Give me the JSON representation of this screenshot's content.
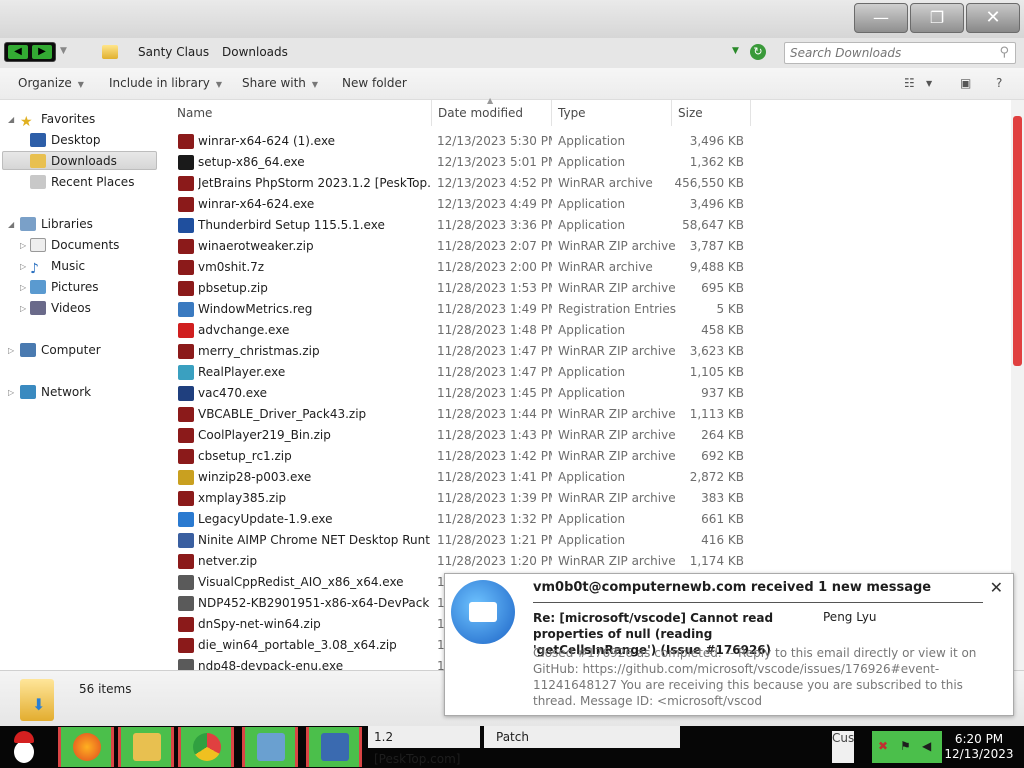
{
  "window": {
    "min_glyph": "—",
    "max_glyph": "❐",
    "close_glyph": "✕"
  },
  "address": {
    "crumbs": [
      "Santy Claus",
      "Downloads"
    ],
    "search_placeholder": "Search Downloads"
  },
  "toolbar": {
    "organize": "Organize",
    "include": "Include in library",
    "share": "Share with",
    "new_folder": "New folder",
    "help": "?"
  },
  "sidebar": {
    "favorites": "Favorites",
    "desktop": "Desktop",
    "downloads": "Downloads",
    "recent": "Recent Places",
    "libraries": "Libraries",
    "documents": "Documents",
    "music": "Music",
    "pictures": "Pictures",
    "videos": "Videos",
    "computer": "Computer",
    "network": "Network"
  },
  "columns": {
    "name": "Name",
    "date": "Date modified",
    "type": "Type",
    "size": "Size"
  },
  "files": [
    {
      "name": "winrar-x64-624 (1).exe",
      "date": "12/13/2023 5:30 PM",
      "type": "Application",
      "size": "3,496 KB",
      "color": "#8b1a1a"
    },
    {
      "name": "setup-x86_64.exe",
      "date": "12/13/2023 5:01 PM",
      "type": "Application",
      "size": "1,362 KB",
      "color": "#1a1a1a"
    },
    {
      "name": "JetBrains PhpStorm 2023.1.2 [PeskTop.co...",
      "date": "12/13/2023 4:52 PM",
      "type": "WinRAR archive",
      "size": "456,550 KB",
      "color": "#8b1a1a"
    },
    {
      "name": "winrar-x64-624.exe",
      "date": "12/13/2023 4:49 PM",
      "type": "Application",
      "size": "3,496 KB",
      "color": "#8b1a1a"
    },
    {
      "name": "Thunderbird Setup 115.5.1.exe",
      "date": "11/28/2023 3:36 PM",
      "type": "Application",
      "size": "58,647 KB",
      "color": "#1f4f9e"
    },
    {
      "name": "winaerotweaker.zip",
      "date": "11/28/2023 2:07 PM",
      "type": "WinRAR ZIP archive",
      "size": "3,787 KB",
      "color": "#8b1a1a"
    },
    {
      "name": "vm0shit.7z",
      "date": "11/28/2023 2:00 PM",
      "type": "WinRAR archive",
      "size": "9,488 KB",
      "color": "#8b1a1a"
    },
    {
      "name": "pbsetup.zip",
      "date": "11/28/2023 1:53 PM",
      "type": "WinRAR ZIP archive",
      "size": "695 KB",
      "color": "#8b1a1a"
    },
    {
      "name": "WindowMetrics.reg",
      "date": "11/28/2023 1:49 PM",
      "type": "Registration Entries",
      "size": "5 KB",
      "color": "#3a7ac0"
    },
    {
      "name": "advchange.exe",
      "date": "11/28/2023 1:48 PM",
      "type": "Application",
      "size": "458 KB",
      "color": "#d01f1f"
    },
    {
      "name": "merry_christmas.zip",
      "date": "11/28/2023 1:47 PM",
      "type": "WinRAR ZIP archive",
      "size": "3,623 KB",
      "color": "#8b1a1a"
    },
    {
      "name": "RealPlayer.exe",
      "date": "11/28/2023 1:47 PM",
      "type": "Application",
      "size": "1,105 KB",
      "color": "#3aa0c0"
    },
    {
      "name": "vac470.exe",
      "date": "11/28/2023 1:45 PM",
      "type": "Application",
      "size": "937 KB",
      "color": "#1f3f7e"
    },
    {
      "name": "VBCABLE_Driver_Pack43.zip",
      "date": "11/28/2023 1:44 PM",
      "type": "WinRAR ZIP archive",
      "size": "1,113 KB",
      "color": "#8b1a1a"
    },
    {
      "name": "CoolPlayer219_Bin.zip",
      "date": "11/28/2023 1:43 PM",
      "type": "WinRAR ZIP archive",
      "size": "264 KB",
      "color": "#8b1a1a"
    },
    {
      "name": "cbsetup_rc1.zip",
      "date": "11/28/2023 1:42 PM",
      "type": "WinRAR ZIP archive",
      "size": "692 KB",
      "color": "#8b1a1a"
    },
    {
      "name": "winzip28-p003.exe",
      "date": "11/28/2023 1:41 PM",
      "type": "Application",
      "size": "2,872 KB",
      "color": "#c9a020"
    },
    {
      "name": "xmplay385.zip",
      "date": "11/28/2023 1:39 PM",
      "type": "WinRAR ZIP archive",
      "size": "383 KB",
      "color": "#8b1a1a"
    },
    {
      "name": "LegacyUpdate-1.9.exe",
      "date": "11/28/2023 1:32 PM",
      "type": "Application",
      "size": "661 KB",
      "color": "#2a7ad0"
    },
    {
      "name": "Ninite AIMP Chrome NET Desktop Runti...",
      "date": "11/28/2023 1:21 PM",
      "type": "Application",
      "size": "416 KB",
      "color": "#3a5fa0"
    },
    {
      "name": "netver.zip",
      "date": "11/28/2023 1:20 PM",
      "type": "WinRAR ZIP archive",
      "size": "1,174 KB",
      "color": "#8b1a1a"
    },
    {
      "name": "VisualCppRedist_AIO_x86_x64.exe",
      "date": "1",
      "type": "",
      "size": "",
      "color": "#5a5a5a"
    },
    {
      "name": "NDP452-KB2901951-x86-x64-DevPack.exe",
      "date": "1",
      "type": "",
      "size": "",
      "color": "#5a5a5a"
    },
    {
      "name": "dnSpy-net-win64.zip",
      "date": "1",
      "type": "",
      "size": "",
      "color": "#8b1a1a"
    },
    {
      "name": "die_win64_portable_3.08_x64.zip",
      "date": "1",
      "type": "",
      "size": "",
      "color": "#8b1a1a"
    },
    {
      "name": "ndp48-devpack-enu.exe",
      "date": "1",
      "type": "",
      "size": "",
      "color": "#5a5a5a"
    }
  ],
  "details": {
    "count": "56 items"
  },
  "notification": {
    "heading": "vm0b0t@computernewb.com received 1 new message",
    "subject": "Re: [microsoft/vscode] Cannot read properties of null (reading 'getCellsInRange') (Issue #176926)",
    "sender": "Peng Lyu",
    "body": "Closed #176926 as completed. -- Reply to this email directly or view it on GitHub: https://github.com/microsoft/vscode/issues/176926#event-11241648127 You are receiving this because you are subscribed to this thread. Message ID: <microsoft/vscod",
    "close_glyph": "✕"
  },
  "taskbar": {
    "label_1": "1.2 [PeskTop.com]",
    "label_2": "Patch",
    "tray_text": "Cus",
    "time": "6:20 PM",
    "date": "12/13/2023"
  }
}
